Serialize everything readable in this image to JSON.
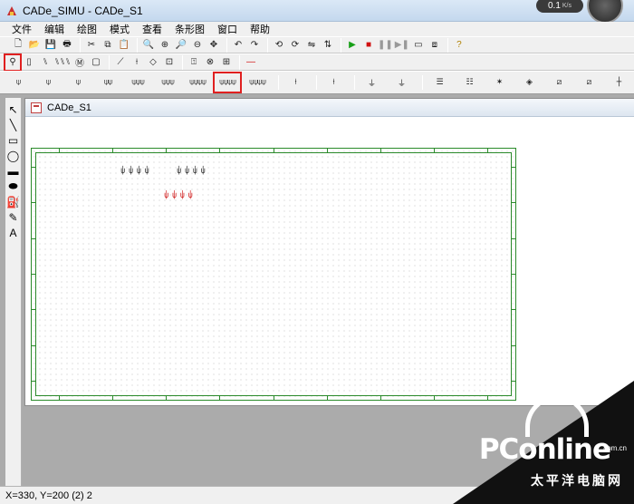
{
  "window": {
    "title": "CADe_SIMU - CADe_S1"
  },
  "net_meter": {
    "value": "0.1",
    "unit": "K/s"
  },
  "menu": [
    "文件",
    "编辑",
    "绘图",
    "模式",
    "查看",
    "条形图",
    "窗口",
    "帮助"
  ],
  "toolbar_standard": [
    {
      "name": "new-icon",
      "glyph": "🗋"
    },
    {
      "name": "open-icon",
      "glyph": "📂"
    },
    {
      "name": "save-icon",
      "glyph": "💾"
    },
    {
      "name": "print-icon",
      "glyph": "🖶"
    },
    {
      "name": "sep"
    },
    {
      "name": "cut-icon",
      "glyph": "✂"
    },
    {
      "name": "copy-icon",
      "glyph": "⧉"
    },
    {
      "name": "paste-icon",
      "glyph": "📋"
    },
    {
      "name": "sep"
    },
    {
      "name": "print-preview-icon",
      "glyph": "🔍"
    },
    {
      "name": "zoom-in-icon",
      "glyph": "⊕"
    },
    {
      "name": "zoom-icon",
      "glyph": "🔎"
    },
    {
      "name": "zoom-out-icon",
      "glyph": "⊖"
    },
    {
      "name": "pan-icon",
      "glyph": "✥"
    },
    {
      "name": "sep"
    },
    {
      "name": "undo-icon",
      "glyph": "↶"
    },
    {
      "name": "redo-icon",
      "glyph": "↷"
    },
    {
      "name": "sep"
    },
    {
      "name": "rotate-left-icon",
      "glyph": "⟲"
    },
    {
      "name": "rotate-right-icon",
      "glyph": "⟳"
    },
    {
      "name": "mirror-h-icon",
      "glyph": "⇋"
    },
    {
      "name": "mirror-v-icon",
      "glyph": "⇅"
    },
    {
      "name": "sep"
    },
    {
      "name": "simulate-run-icon",
      "glyph": "▶",
      "cls": "green"
    },
    {
      "name": "simulate-stop-icon",
      "glyph": "■",
      "cls": "red"
    },
    {
      "name": "simulate-pause-icon",
      "glyph": "❚❚",
      "cls": "gray"
    },
    {
      "name": "simulate-step-icon",
      "glyph": "▶❚",
      "cls": "gray"
    },
    {
      "name": "window-icon",
      "glyph": "▭"
    },
    {
      "name": "component-icon",
      "glyph": "⧈"
    },
    {
      "name": "sep"
    },
    {
      "name": "help-icon",
      "glyph": "?",
      "cls": "yellow"
    }
  ],
  "toolbar_categories": [
    {
      "name": "power-supply-icon",
      "glyph": "⚲",
      "hl": true
    },
    {
      "name": "fuse-icon",
      "glyph": "▯"
    },
    {
      "name": "breaker-icon",
      "glyph": "⑊"
    },
    {
      "name": "breaker-3p-icon",
      "glyph": "⑊⑊⑊"
    },
    {
      "name": "motor-icon",
      "glyph": "Ⓜ"
    },
    {
      "name": "relay-icon",
      "glyph": "▢"
    },
    {
      "name": "sep"
    },
    {
      "name": "contact-no-icon",
      "glyph": "⟋"
    },
    {
      "name": "contact-nc-icon",
      "glyph": "⟊"
    },
    {
      "name": "sensor-icon",
      "glyph": "◇"
    },
    {
      "name": "coil-icon",
      "glyph": "⊡"
    },
    {
      "name": "sep"
    },
    {
      "name": "pushbutton-icon",
      "glyph": "⍐"
    },
    {
      "name": "lamp-icon",
      "glyph": "⊗"
    },
    {
      "name": "terminal-icon",
      "glyph": "⊞"
    },
    {
      "name": "sep"
    },
    {
      "name": "wire-icon",
      "glyph": "—",
      "cls": "red"
    }
  ],
  "toolbar_components": [
    {
      "name": "switch-1p-icon",
      "glyph": "⍦"
    },
    {
      "name": "switch-1p-b-icon",
      "glyph": "⍦"
    },
    {
      "name": "switch-1p-c-icon",
      "glyph": "⍦"
    },
    {
      "name": "switch-2p-icon",
      "glyph": "⍦⍦"
    },
    {
      "name": "switch-3p-icon",
      "glyph": "⍦⍦⍦"
    },
    {
      "name": "switch-3p-b-icon",
      "glyph": "⍦⍦⍦"
    },
    {
      "name": "switch-4p-icon",
      "glyph": "⍦⍦⍦⍦"
    },
    {
      "name": "switch-4p-selected-icon",
      "glyph": "⍦⍦⍦⍦",
      "hl": true
    },
    {
      "name": "switch-4p-nc-icon",
      "glyph": "⍦⍦⍦⍦"
    },
    {
      "name": "sep"
    },
    {
      "name": "fuse-1p-icon",
      "glyph": "⍿"
    },
    {
      "name": "sep"
    },
    {
      "name": "fuse-2p-icon",
      "glyph": "⍿"
    },
    {
      "name": "sep"
    },
    {
      "name": "ground-switch-icon",
      "glyph": "⏚"
    },
    {
      "name": "earth-icon",
      "glyph": "⏚"
    },
    {
      "name": "sep"
    },
    {
      "name": "transformer-icon",
      "glyph": "☰"
    },
    {
      "name": "transformer-b-icon",
      "glyph": "☷"
    },
    {
      "name": "star-icon",
      "glyph": "✶"
    },
    {
      "name": "connector-icon",
      "glyph": "◈"
    },
    {
      "name": "variator-icon",
      "glyph": "⧄"
    },
    {
      "name": "variator-b-icon",
      "glyph": "⧄"
    },
    {
      "name": "plus-icon",
      "glyph": "┼"
    },
    {
      "name": "sep"
    },
    {
      "name": "diamond-icon",
      "glyph": "◇"
    }
  ],
  "palette": [
    {
      "name": "select-arrow-icon",
      "glyph": "↖"
    },
    {
      "name": "line-tool-icon",
      "glyph": "╲"
    },
    {
      "name": "rectangle-tool-icon",
      "glyph": "▭"
    },
    {
      "name": "ellipse-tool-icon",
      "glyph": "◯"
    },
    {
      "name": "filled-rectangle-tool-icon",
      "glyph": "▬"
    },
    {
      "name": "filled-ellipse-tool-icon",
      "glyph": "⬬"
    },
    {
      "name": "fill-bucket-icon",
      "glyph": "⛽"
    },
    {
      "name": "color-picker-icon",
      "glyph": "✎"
    },
    {
      "name": "text-tool-icon",
      "glyph": "A"
    }
  ],
  "document": {
    "tab_title": "CADe_S1"
  },
  "canvas_symbols": {
    "group_a": "⍦ ⍦ ⍦ ⍦",
    "group_b": "⍦ ⍦ ⍦ ⍦",
    "group_c": "⍦ ⍦ ⍦ ⍦"
  },
  "status": {
    "text": "X=330, Y=200 (2) 2"
  },
  "watermark": {
    "brand": "PConline",
    "domain": ".com.cn",
    "subtitle": "太平洋电脑网"
  }
}
